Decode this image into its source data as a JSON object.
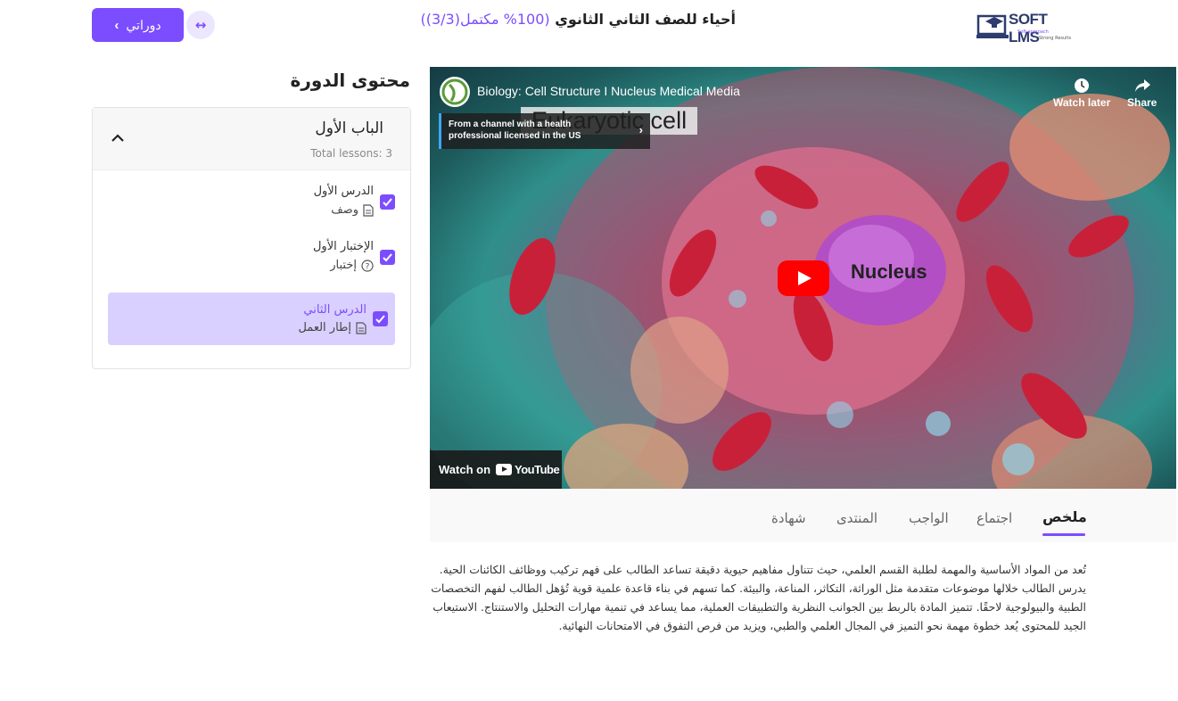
{
  "header": {
    "back_label": "دوراتي",
    "course_title": "أحياء للصف الثاني الثانوي",
    "progress_text": "(100% مكتمل(3/3))",
    "logo_text": "SOFT LMS",
    "logo_tagline_1": "Soft approach",
    "logo_tagline_2": "Strong Results"
  },
  "sidebar": {
    "heading": "محتوى الدورة",
    "chapter": {
      "title": "الباب الأول",
      "total_lessons": "Total lessons: 3",
      "lessons": [
        {
          "name": "الدرس الأول",
          "type": "وصف",
          "icon": "document-icon",
          "completed": true,
          "active": false
        },
        {
          "name": "الإختبار الأول",
          "type": "إختبار",
          "icon": "question-circle-icon",
          "completed": true,
          "active": false
        },
        {
          "name": "الدرس الثاني",
          "type": "إطار العمل",
          "icon": "document-icon",
          "completed": true,
          "active": true
        }
      ]
    }
  },
  "video": {
    "title": "Biology: Cell Structure I Nucleus Medical Media",
    "watch_later": "Watch later",
    "share": "Share",
    "info_panel": "From a channel with a health professional licensed in the US",
    "overlay_label": "Eukaryotic cell",
    "nucleus_label": "Nucleus",
    "watch_on": "Watch on",
    "youtube": "YouTube"
  },
  "tabs": [
    {
      "label": "ملخص",
      "active": true
    },
    {
      "label": "اجتماع",
      "active": false
    },
    {
      "label": "الواجب",
      "active": false
    },
    {
      "label": "المنتدى",
      "active": false
    },
    {
      "label": "شهادة",
      "active": false
    }
  ],
  "summary": "تُعد من المواد الأساسية والمهمة لطلبة القسم العلمي، حيث تتناول مفاهيم حيوية دقيقة تساعد الطالب على فهم تركيب ووظائف الكائنات الحية. يدرس الطالب خلالها موضوعات متقدمة مثل الوراثة، التكاثر، المناعة، والبيئة. كما تسهم في بناء قاعدة علمية قوية تُؤهل الطالب لفهم التخصصات الطبية والبيولوجية لاحقًا. تتميز المادة بالربط بين الجوانب النظرية والتطبيقات العملية، مما يساعد في تنمية مهارات التحليل والاستنتاج. الاستيعاب الجيد للمحتوى يُعد خطوة مهمة نحو التميز في المجال العلمي والطبي، ويزيد من فرص التفوق في الامتحانات النهائية.",
  "colors": {
    "accent": "#7c4dff",
    "active_lesson_bg": "#d9d0ff",
    "youtube_red": "#ff0000"
  }
}
